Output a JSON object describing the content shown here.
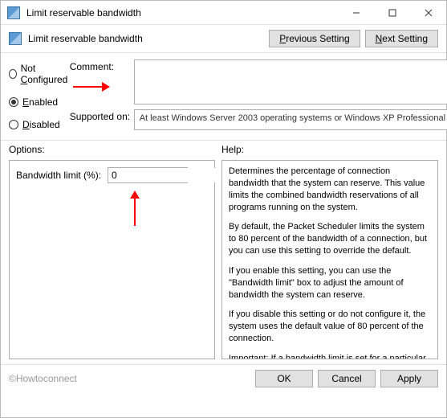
{
  "window": {
    "title": "Limit reservable bandwidth",
    "watermark": "©Howtoconnect"
  },
  "header": {
    "title": "Limit reservable bandwidth",
    "prev_label": "Previous Setting",
    "next_label": "Next Setting"
  },
  "radios": {
    "not_configured": "Not Configured",
    "enabled": "Enabled",
    "disabled": "Disabled",
    "selected": "enabled"
  },
  "fields": {
    "comment_label": "Comment:",
    "comment_value": "",
    "supported_label": "Supported on:",
    "supported_value": "At least Windows Server 2003 operating systems or Windows XP Professional"
  },
  "sections": {
    "options_label": "Options:",
    "help_label": "Help:"
  },
  "options": {
    "bandwidth_label": "Bandwidth limit (%):",
    "bandwidth_value": "0"
  },
  "help": {
    "p1": "Determines the percentage of connection bandwidth that the system can reserve. This value limits the combined bandwidth reservations of all programs running on the system.",
    "p2": "By default, the Packet Scheduler limits the system to 80 percent of the bandwidth of a connection, but you can use this setting to override the default.",
    "p3": "If you enable this setting, you can use the \"Bandwidth limit\" box to adjust the amount of bandwidth the system can reserve.",
    "p4": "If you disable this setting or do not configure it, the system uses the default value of 80 percent of the connection.",
    "p5": "Important: If a bandwidth limit is set for a particular network adapter in the registry, this setting is ignored when configuring that network adapter."
  },
  "footer": {
    "ok": "OK",
    "cancel": "Cancel",
    "apply": "Apply"
  }
}
